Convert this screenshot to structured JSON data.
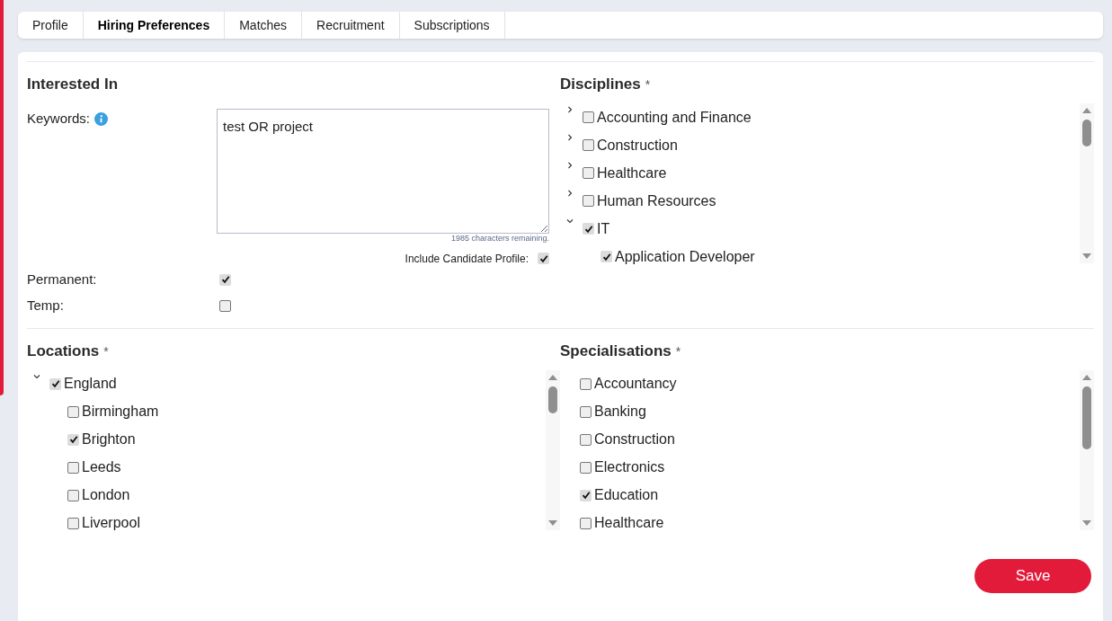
{
  "tabs": [
    {
      "label": "Profile",
      "selected": false
    },
    {
      "label": "Hiring Preferences",
      "selected": true
    },
    {
      "label": "Matches",
      "selected": false
    },
    {
      "label": "Recruitment",
      "selected": false
    },
    {
      "label": "Subscriptions",
      "selected": false
    }
  ],
  "interested_in": {
    "heading": "Interested In",
    "keywords_label": "Keywords:",
    "keywords_value": "test OR project",
    "characters_remaining": "1985 characters remaining.",
    "include_profile": {
      "label": "Include Candidate Profile:",
      "checked": true
    },
    "options": [
      {
        "label": "Permanent:",
        "checked": true
      },
      {
        "label": "Temp:",
        "checked": false
      }
    ]
  },
  "disciplines": {
    "heading": "Disciplines",
    "required": "*",
    "items": [
      {
        "label": "Accounting and Finance",
        "checked": false,
        "expanded": false
      },
      {
        "label": "Construction",
        "checked": false,
        "expanded": false
      },
      {
        "label": "Healthcare",
        "checked": false,
        "expanded": false
      },
      {
        "label": "Human Resources",
        "checked": false,
        "expanded": false
      },
      {
        "label": "IT",
        "checked": true,
        "expanded": true,
        "children": [
          {
            "label": "Application Developer",
            "checked": true
          }
        ]
      }
    ]
  },
  "locations": {
    "heading": "Locations",
    "required": "*",
    "items": [
      {
        "label": "England",
        "checked": true,
        "expanded": true,
        "children": [
          {
            "label": "Birmingham",
            "checked": false
          },
          {
            "label": "Brighton",
            "checked": true
          },
          {
            "label": "Leeds",
            "checked": false
          },
          {
            "label": "London",
            "checked": false
          },
          {
            "label": "Liverpool",
            "checked": false
          }
        ]
      }
    ]
  },
  "specialisations": {
    "heading": "Specialisations",
    "required": "*",
    "items": [
      {
        "label": "Accountancy",
        "checked": false
      },
      {
        "label": "Banking",
        "checked": false
      },
      {
        "label": "Construction",
        "checked": false
      },
      {
        "label": "Electronics",
        "checked": false
      },
      {
        "label": "Education",
        "checked": true
      },
      {
        "label": "Healthcare",
        "checked": false
      }
    ]
  },
  "save_button": "Save"
}
